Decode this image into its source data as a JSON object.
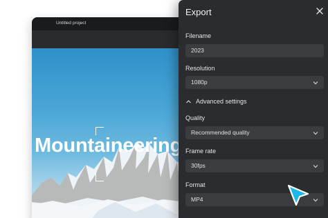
{
  "editor": {
    "title": "Untitled project",
    "canvas_headline": "Mountaineering"
  },
  "export_panel": {
    "title": "Export",
    "filename": {
      "label": "Filename",
      "value": "2023"
    },
    "resolution": {
      "label": "Resolution",
      "value": "1080p"
    },
    "advanced": {
      "label": "Advanced settings",
      "expanded": true
    },
    "quality": {
      "label": "Quality",
      "value": "Recommended quality"
    },
    "frame_rate": {
      "label": "Frame rate",
      "value": "30fps"
    },
    "format": {
      "label": "Format",
      "value": "MP4"
    }
  },
  "icons": [
    "close-icon",
    "chevron-down-icon",
    "chevron-up-icon",
    "cursor-pointer-icon"
  ],
  "colors": {
    "panel_bg": "#2b2c2f",
    "field_bg": "#3b3c40",
    "cursor_accent": "#1fb6e8"
  }
}
